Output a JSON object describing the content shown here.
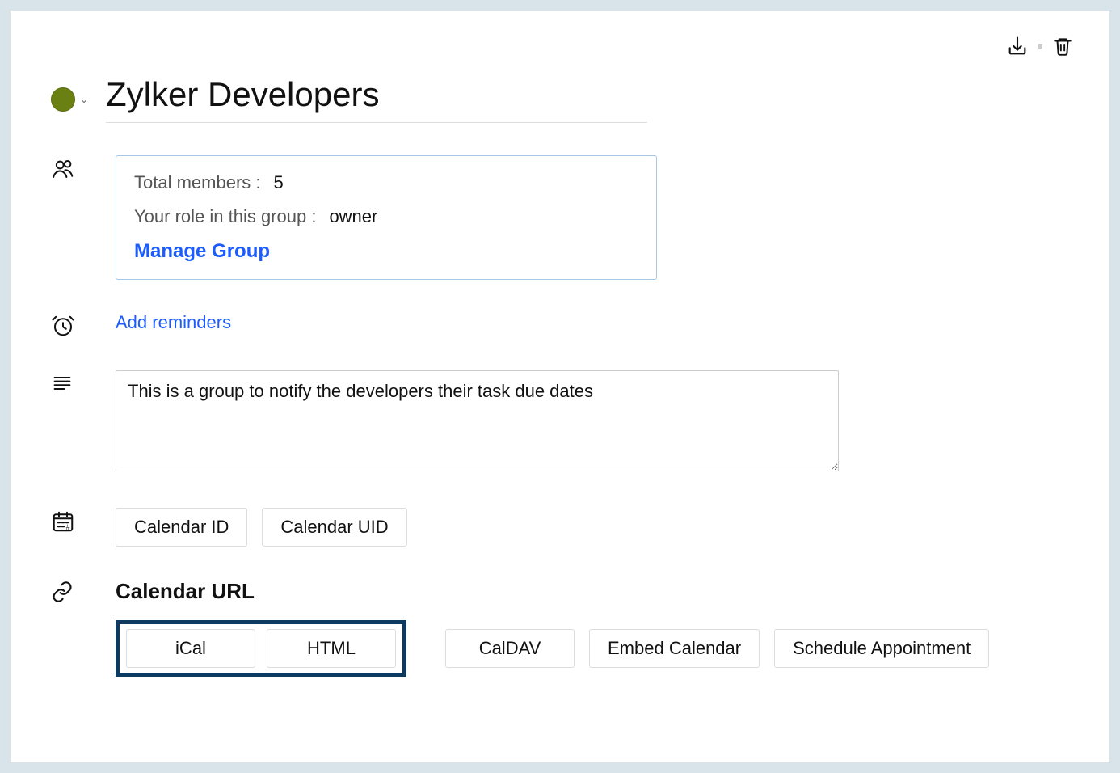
{
  "header": {
    "title": "Zylker Developers",
    "color": "#6b8013"
  },
  "members": {
    "total_label": "Total members :",
    "total_value": "5",
    "role_label": "Your role in this group :",
    "role_value": "owner",
    "manage_label": "Manage Group"
  },
  "reminders": {
    "add_label": "Add reminders"
  },
  "description": {
    "text": "This is a group to notify the developers their task due dates"
  },
  "calendar_ids": {
    "id_btn": "Calendar ID",
    "uid_btn": "Calendar UID"
  },
  "calendar_url": {
    "heading": "Calendar URL",
    "ical": "iCal",
    "html": "HTML",
    "caldav": "CalDAV",
    "embed": "Embed Calendar",
    "schedule": "Schedule Appointment"
  }
}
